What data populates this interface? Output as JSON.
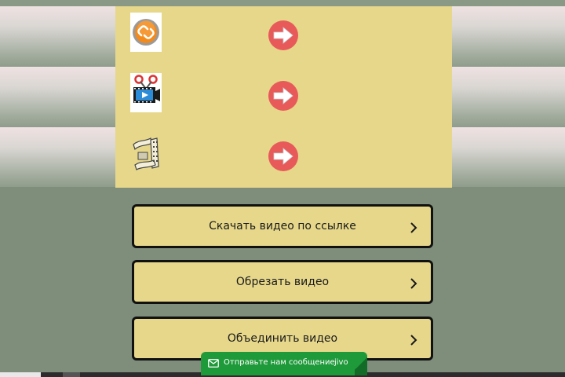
{
  "rows": [
    {
      "icon": "link-icon",
      "action": "arrow-right-icon"
    },
    {
      "icon": "video-cut-icon",
      "action": "arrow-right-icon"
    },
    {
      "icon": "film-strip-icon",
      "action": "arrow-right-icon"
    }
  ],
  "buttons": [
    {
      "label": "Скачать видео по ссылке",
      "icon": "chevron-right-icon"
    },
    {
      "label": "Обрезать видео",
      "icon": "chevron-right-icon"
    },
    {
      "label": "Объединить видео",
      "icon": "chevron-right-icon"
    }
  ],
  "chat": {
    "text": "Отправьте нам сообщение",
    "brand": "jivo",
    "icon": "mail-icon"
  },
  "colors": {
    "page_bg": "#7e8e7b",
    "panel_bg": "#e6d78a",
    "arrow_red": "#e85a5a",
    "chat_green": "#1f9a3a",
    "button_border": "#111111"
  }
}
